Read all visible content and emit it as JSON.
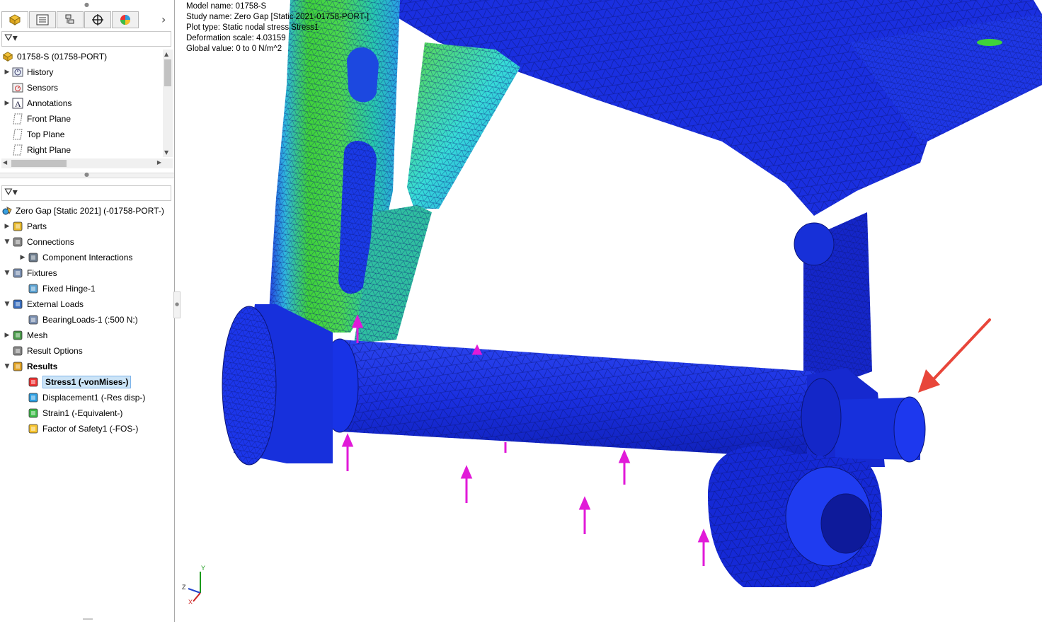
{
  "feature_manager": {
    "tabs": [
      {
        "icon": "feature-manager-tab-icon"
      },
      {
        "icon": "property-manager-tab-icon"
      },
      {
        "icon": "configuration-manager-tab-icon"
      },
      {
        "icon": "dimxpert-manager-tab-icon"
      },
      {
        "icon": "display-manager-tab-icon"
      }
    ],
    "more_tabs_glyph": "›",
    "root": {
      "label": "01758-S  (01758-PORT)"
    },
    "items": [
      {
        "label": "History",
        "icon": "history-icon",
        "expandable": true
      },
      {
        "label": "Sensors",
        "icon": "sensors-icon",
        "expandable": false
      },
      {
        "label": "Annotations",
        "icon": "annotations-icon",
        "expandable": true
      },
      {
        "label": "Front Plane",
        "icon": "plane-icon",
        "expandable": false
      },
      {
        "label": "Top Plane",
        "icon": "plane-icon",
        "expandable": false
      },
      {
        "label": "Right Plane",
        "icon": "plane-icon",
        "expandable": false
      }
    ]
  },
  "simulation_tree": {
    "study": {
      "label": "Zero Gap [Static 2021] (-01758-PORT-)"
    },
    "items": [
      {
        "label": "Parts",
        "icon": "parts-icon",
        "level": 0,
        "expander": "›"
      },
      {
        "label": "Connections",
        "icon": "connections-icon",
        "level": 0,
        "expander": "⌄"
      },
      {
        "label": "Component Interactions",
        "icon": "component-interactions-icon",
        "level": 1,
        "expander": "›"
      },
      {
        "label": "Fixtures",
        "icon": "fixtures-icon",
        "level": 0,
        "expander": "⌄"
      },
      {
        "label": "Fixed Hinge-1",
        "icon": "fixed-hinge-icon",
        "level": 1,
        "expander": ""
      },
      {
        "label": "External Loads",
        "icon": "external-loads-icon",
        "level": 0,
        "expander": "⌄"
      },
      {
        "label": "BearingLoads-1 (:500 N:)",
        "icon": "bearing-load-icon",
        "level": 1,
        "expander": ""
      },
      {
        "label": "Mesh",
        "icon": "mesh-icon",
        "level": 0,
        "expander": "›"
      },
      {
        "label": "Result Options",
        "icon": "result-options-icon",
        "level": 0,
        "expander": ""
      },
      {
        "label": "Results",
        "icon": "results-folder-icon",
        "level": 0,
        "expander": "⌄",
        "bold": true
      },
      {
        "label": "Stress1 (-vonMises-)",
        "icon": "stress-plot-icon",
        "level": 1,
        "expander": "",
        "selected": true
      },
      {
        "label": "Displacement1 (-Res disp-)",
        "icon": "displacement-plot-icon",
        "level": 1,
        "expander": ""
      },
      {
        "label": "Strain1 (-Equivalent-)",
        "icon": "strain-plot-icon",
        "level": 1,
        "expander": ""
      },
      {
        "label": "Factor of Safety1 (-FOS-)",
        "icon": "fos-plot-icon",
        "level": 1,
        "expander": ""
      }
    ]
  },
  "viewport": {
    "info": {
      "model_name": "Model name: 01758-S",
      "study_name": "Study name: Zero Gap [Static 2021-01758-PORT-]",
      "plot_type": "Plot type: Static nodal stress Stress1",
      "deformation_scale": "Deformation scale: 4.03159",
      "global_value": "Global value: 0 to 0 N/m^2"
    },
    "triad": {
      "x": "X",
      "y": "Y",
      "z": "Z"
    },
    "colors": {
      "mesh_blue": "#1a2fe0",
      "deep_blue": "#0b1a9a",
      "arrow_magenta": "#e11ad8",
      "callout_red": "#e8463a",
      "hot_green": "#3fd23a",
      "stress_cyan": "#24d6e8"
    }
  }
}
